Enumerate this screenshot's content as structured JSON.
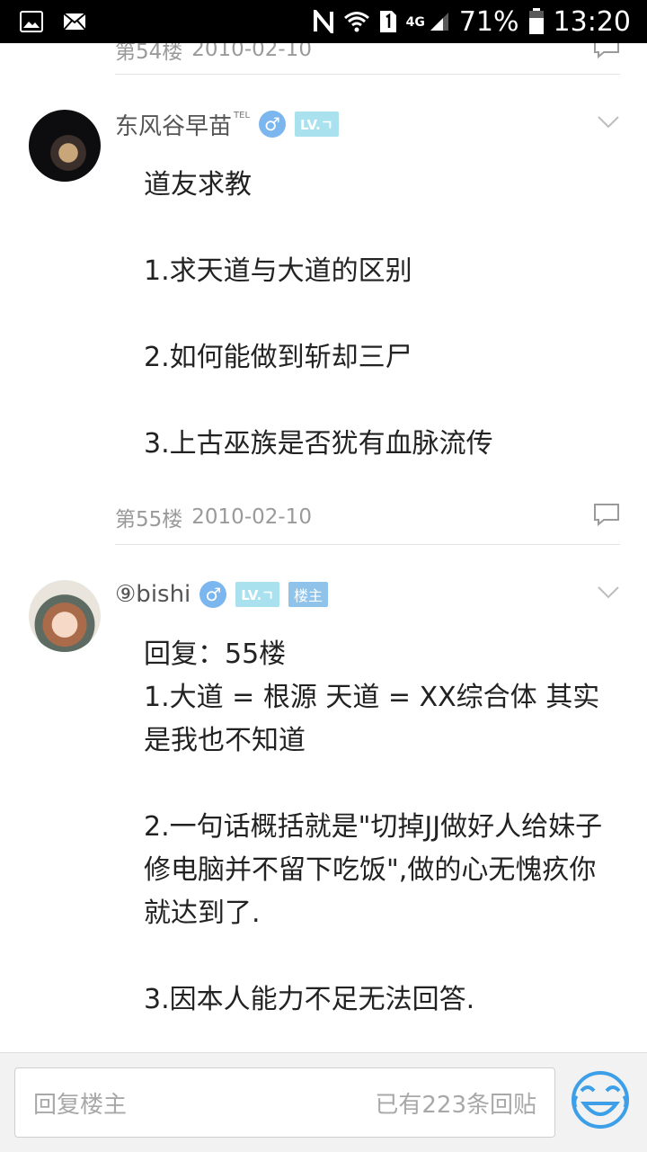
{
  "status_bar": {
    "network_small": "4G",
    "battery_percent": "71%",
    "time": "13:20",
    "icons": [
      "gallery-icon",
      "mail-icon",
      "nfc-icon",
      "wifi-icon",
      "sim-icon",
      "signal-icon",
      "battery-icon"
    ]
  },
  "floors": [
    {
      "label": "第54楼",
      "date": "2010-02-10"
    },
    {
      "label": "第55楼",
      "date": "2010-02-10"
    }
  ],
  "posts": [
    {
      "username": "东风谷早苗",
      "tel": "TEL",
      "gender": "♂",
      "level": "LV.ㄱ",
      "paragraphs": [
        "道友求教",
        "1.求天道与大道的区别",
        "2.如何能做到斩却三尸",
        "3.上古巫族是否犹有血脉流传"
      ]
    },
    {
      "username": "⑨bishi",
      "gender": "♂",
      "level": "LV.ㄱ",
      "owner_badge": "楼主",
      "paragraphs": [
        "回复：55楼",
        "1.大道 = 根源   天道 = XX综合体 其实是我也不知道",
        "2.一句话概括就是\"切掉JJ做好人给妹子修电脑并不留下吃饭\",做的心无愧疚你就达到了.",
        "3.因本人能力不足无法回答."
      ]
    }
  ],
  "reply_bar": {
    "placeholder": "回复楼主",
    "count_text": "已有223条回贴"
  },
  "colors": {
    "accent_blue": "#3c9fe8",
    "gender_badge": "#7bb6ef",
    "level_badge": "#a9e2ee",
    "owner_badge": "#8fc3ea"
  }
}
